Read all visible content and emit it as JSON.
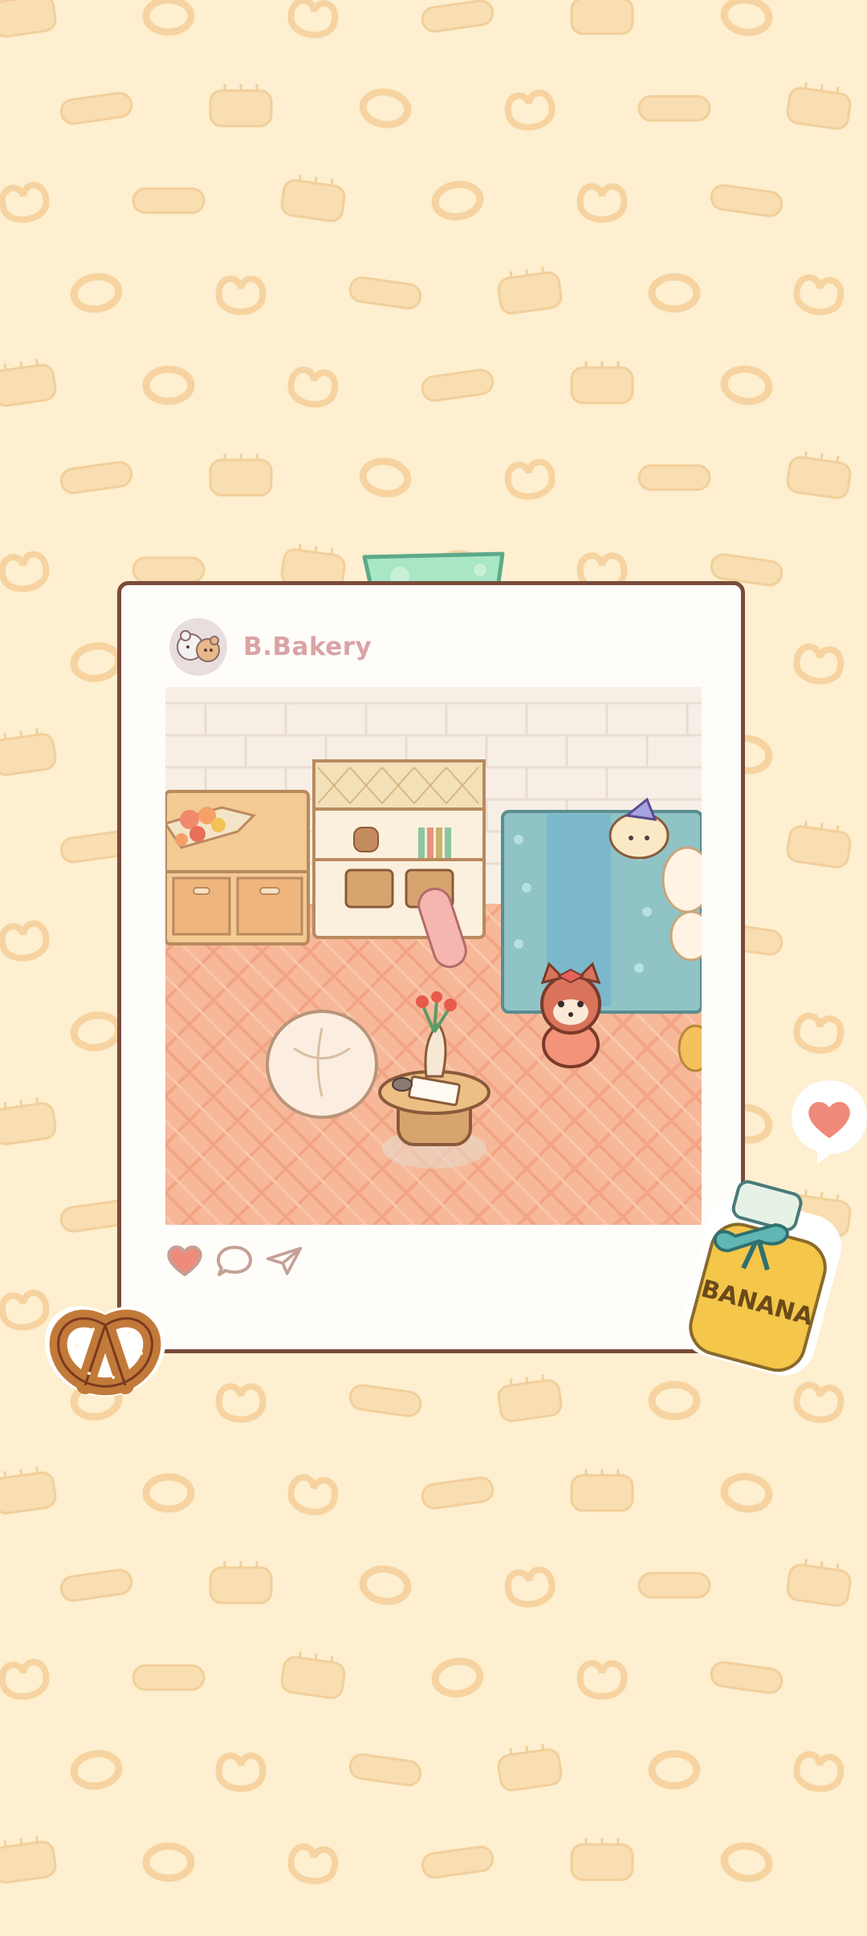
{
  "post": {
    "username": "B.Bakery",
    "avatar_icon": "bear-avatar-icon",
    "actions": {
      "like_icon": "heart-icon",
      "comment_icon": "speech-bubble-icon",
      "share_icon": "paper-plane-icon"
    }
  },
  "stickers": {
    "jar_label": "BANANA",
    "pretzel_icon": "pretzel-icon",
    "floating_heart_icon": "heart-bubble-icon"
  },
  "colors": {
    "background": "#fdefcf",
    "card_border": "#7a4a3a",
    "username": "#d9a4a4",
    "tape": "#a8e6c4",
    "like_heart": "#f08a7a"
  }
}
